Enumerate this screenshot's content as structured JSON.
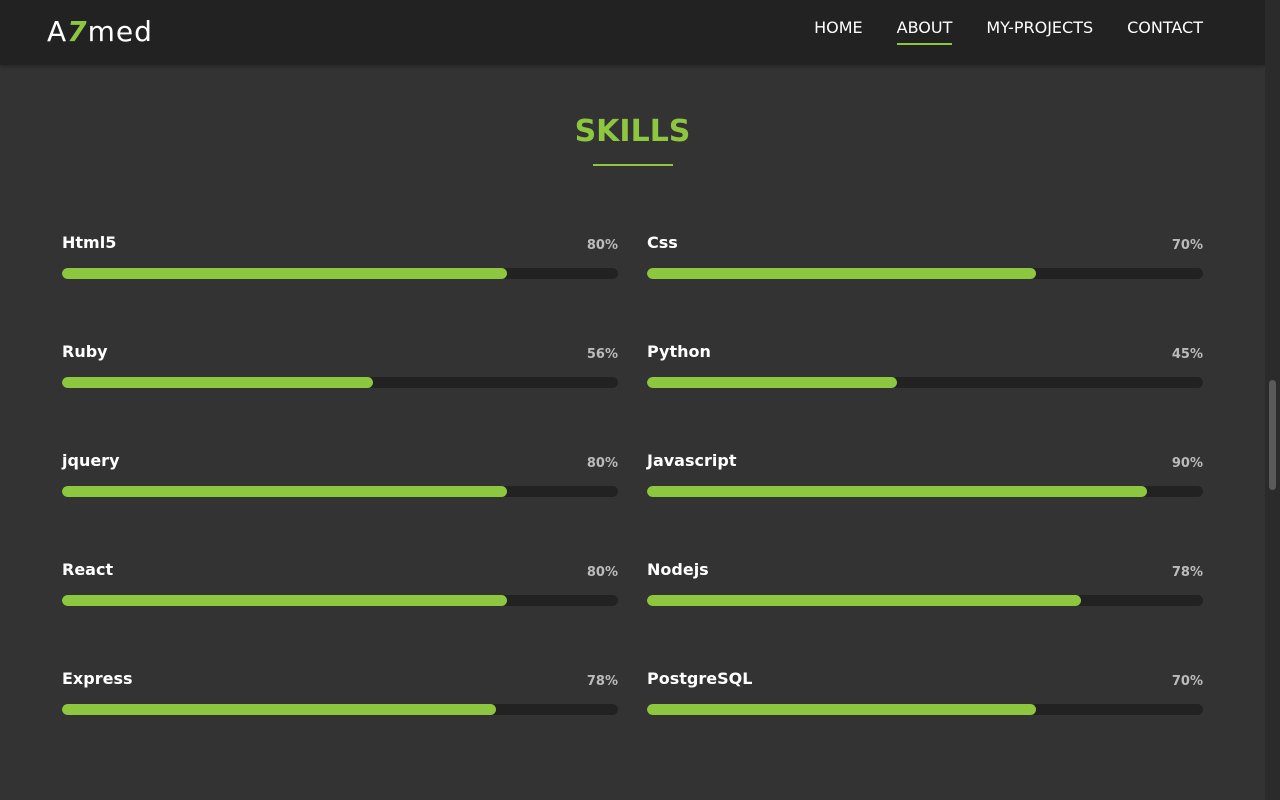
{
  "nav": {
    "logo": {
      "prefix": "A",
      "accent": "7",
      "suffix": "med"
    },
    "links": [
      "HOME",
      "ABOUT",
      "MY-PROJECTS",
      "CONTACT"
    ],
    "active_link": "ABOUT"
  },
  "skills": {
    "title": "SKILLS",
    "items": [
      {
        "name": "Html5",
        "percent_label": "80%",
        "value": 80
      },
      {
        "name": "Css",
        "percent_label": "70%",
        "value": 70
      },
      {
        "name": "Ruby",
        "percent_label": "56%",
        "value": 56
      },
      {
        "name": "Python",
        "percent_label": "45%",
        "value": 45
      },
      {
        "name": "jquery",
        "percent_label": "80%",
        "value": 80
      },
      {
        "name": "Javascript",
        "percent_label": "90%",
        "value": 90
      },
      {
        "name": "React",
        "percent_label": "80%",
        "value": 80
      },
      {
        "name": "Nodejs",
        "percent_label": "78%",
        "value": 78
      },
      {
        "name": "Express",
        "percent_label": "78%",
        "value": 78
      },
      {
        "name": "PostgreSQL",
        "percent_label": "70%",
        "value": 70
      }
    ]
  },
  "colors": {
    "accent": "#8dc63f",
    "background": "#333333",
    "navbar": "#222222",
    "bar_track": "#222222"
  }
}
